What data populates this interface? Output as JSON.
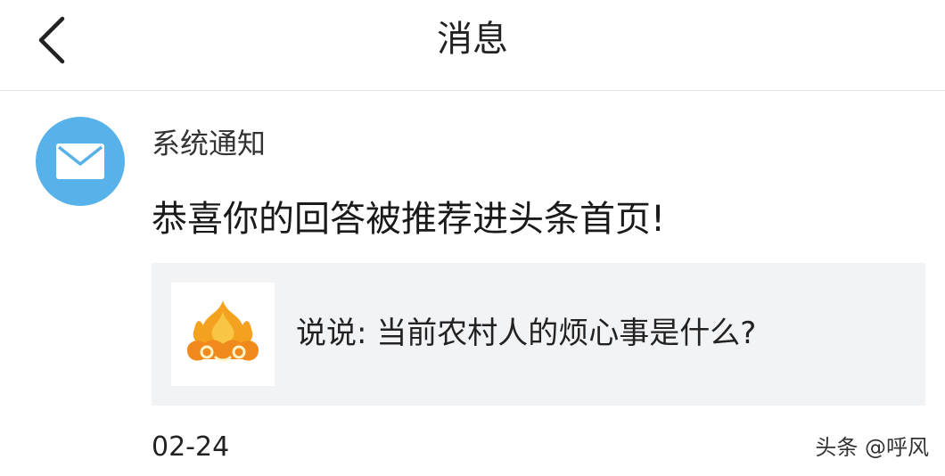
{
  "header": {
    "title": "消息",
    "back_icon": "chevron-left-icon"
  },
  "message": {
    "sender": "系统通知",
    "avatar_icon": "envelope-icon",
    "avatar_color": "#58b2ea",
    "text": "恭喜你的回答被推荐进头条首页!",
    "card": {
      "thumb_icon": "fire-cloud-logo",
      "text": "说说: 当前农村人的烦心事是什么?"
    },
    "date": "02-24"
  },
  "watermark": "头条 @呼风"
}
